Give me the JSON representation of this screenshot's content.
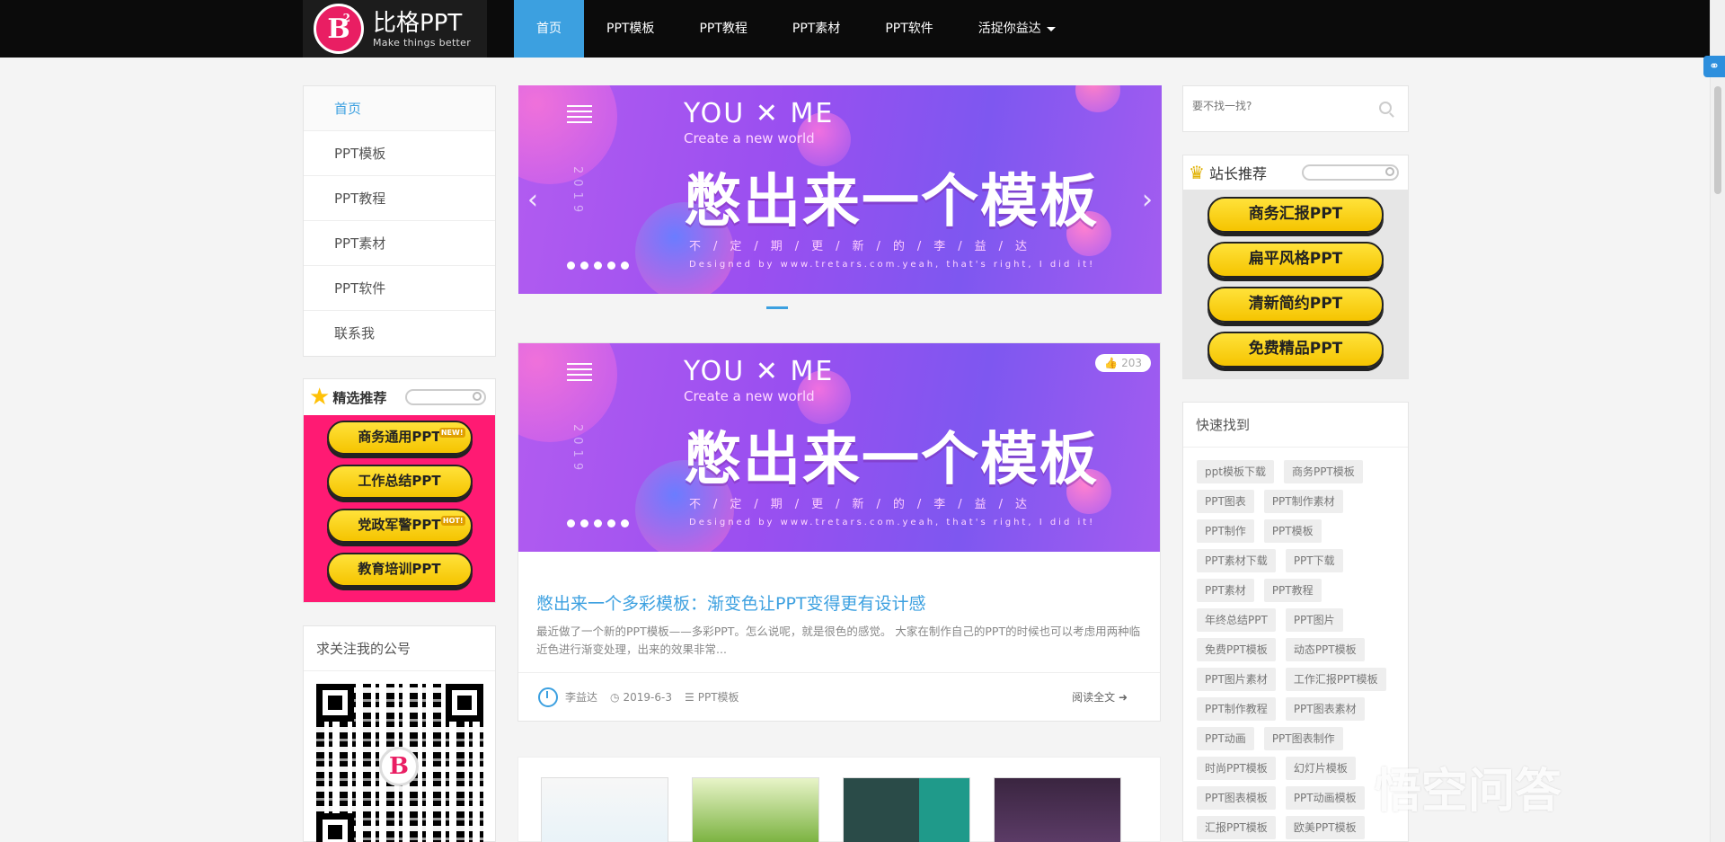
{
  "header": {
    "logo": {
      "name": "比格PPT",
      "slogan": "Make things better",
      "mark": "B"
    },
    "nav": [
      {
        "label": "首页",
        "active": true
      },
      {
        "label": "PPT模板"
      },
      {
        "label": "PPT教程"
      },
      {
        "label": "PPT素材"
      },
      {
        "label": "PPT软件"
      },
      {
        "label": "活捉你益达",
        "dropdown": true
      }
    ]
  },
  "sidebar_left": {
    "menu": [
      "首页",
      "PPT模板",
      "PPT教程",
      "PPT素材",
      "PPT软件",
      "联系我"
    ],
    "featured": {
      "title": "精选推荐",
      "buttons": [
        {
          "label": "商务通用PPT",
          "badge": "NEW!"
        },
        {
          "label": "工作总结PPT",
          "badge": ""
        },
        {
          "label": "党政军警PPT",
          "badge": "HOT!"
        },
        {
          "label": "教育培训PPT",
          "badge": ""
        }
      ]
    },
    "wechat": {
      "title": "求关注我的公号",
      "qr_center": "B"
    }
  },
  "banner": {
    "you_me": "YOU ✕ ME",
    "create": "Create a new world",
    "headline": "憋出来一个模板",
    "sub": "不/定/期/更/新/的/李/益/达",
    "designed": "Designed by www.tretars.com.yeah, that's right, I did it!",
    "year": "2019"
  },
  "post": {
    "likes": "203",
    "title": "憋出来一个多彩模板：渐变色让PPT变得更有设计感",
    "excerpt": "最近做了一个新的PPT模板——多彩PPT。怎么说呢，就是很色的感觉。 大家在制作自己的PPT的时候也可以考虑用两种临近色进行渐变处理，出来的效果非常...",
    "author": "李益达",
    "date": "2019-6-3",
    "category": "PPT模板",
    "read_more": "阅读全文"
  },
  "sidebar_right": {
    "search": {
      "placeholder": "要不找一找?"
    },
    "recommend": {
      "title": "站长推荐",
      "buttons": [
        "商务汇报PPT",
        "扁平风格PPT",
        "清新简约PPT",
        "免费精品PPT"
      ]
    },
    "quick": {
      "title": "快速找到",
      "tags": [
        "ppt模板下载",
        "商务PPT模板",
        "PPT图表",
        "PPT制作素材",
        "PPT制作",
        "PPT模板",
        "PPT素材下载",
        "PPT下载",
        "PPT素材",
        "PPT教程",
        "年终总结PPT",
        "PPT图片",
        "免费PPT模板",
        "动态PPT模板",
        "PPT图片素材",
        "工作汇报PPT模板",
        "PPT制作教程",
        "PPT图表素材",
        "PPT动画",
        "PPT图表制作",
        "时尚PPT模板",
        "幻灯片模板",
        "PPT图表模板",
        "PPT动画模板",
        "汇报PPT模板",
        "欧美PPT模板"
      ]
    }
  },
  "watermark": "悟空问答",
  "colors": {
    "accent": "#3ca0e0",
    "pink": "#ff1a73",
    "gold": "#f5c400",
    "topbar": "#0b0b0b"
  }
}
